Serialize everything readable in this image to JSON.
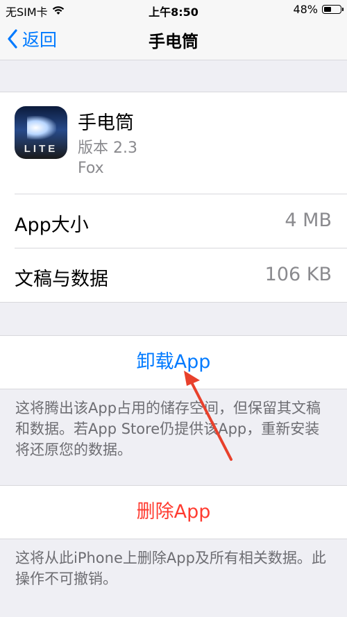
{
  "status_bar": {
    "carrier": "无SIM卡",
    "time": "上午8:50",
    "battery_percent_text": "48%",
    "battery_level": 0.48
  },
  "nav": {
    "back_label": "返回",
    "title": "手电筒"
  },
  "app": {
    "icon_text": "LITE",
    "name": "手电筒",
    "version": "版本 2.3",
    "developer": "Fox"
  },
  "storage": {
    "app_size_label": "App大小",
    "app_size_value": "4 MB",
    "docs_label": "文稿与数据",
    "docs_value": "106 KB"
  },
  "offload": {
    "label": "卸载App",
    "note": "这将腾出该App占用的储存空间，但保留其文稿和数据。若App Store仍提供该App，重新安装将还原您的数据。"
  },
  "delete": {
    "label": "删除App",
    "note": "这将从此iPhone上删除App及所有相关数据。此操作不可撤销。"
  },
  "colors": {
    "accent": "#007aff",
    "destructive": "#ff3b30",
    "annotation_arrow": "#e8412c"
  }
}
